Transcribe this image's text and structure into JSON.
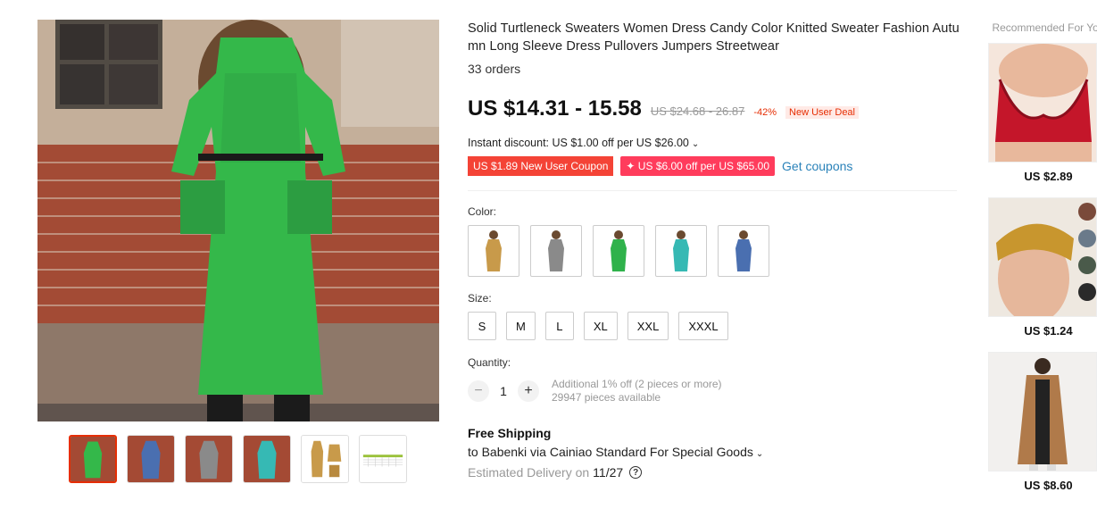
{
  "product": {
    "title": "Solid Turtleneck Sweaters Women Dress Candy Color Knitted Sweater Fashion Autumn Long Sleeve Dress Pullovers Jumpers Streetwear",
    "orders": "33 orders",
    "price": "US $14.31 - 15.58",
    "old_price": "US $24.68 - 26.87",
    "discount": "-42%",
    "deal_badge": "New User Deal",
    "instant_discount": "Instant discount: US $1.00 off per US $26.00",
    "chevron": "⌄",
    "coupon_1": "US $1.89 New User Coupon",
    "coupon_2": "✦ US $6.00 off per US $65.00",
    "get_coupons": "Get coupons"
  },
  "options": {
    "color_label": "Color:",
    "colors": [
      {
        "name": "camel",
        "color": "#c89a4a"
      },
      {
        "name": "gray",
        "color": "#8a8a8a"
      },
      {
        "name": "green",
        "color": "#2fb24b"
      },
      {
        "name": "teal",
        "color": "#36b9b4"
      },
      {
        "name": "blue",
        "color": "#4a6fb0"
      }
    ],
    "size_label": "Size:",
    "sizes": [
      "S",
      "M",
      "L",
      "XL",
      "XXL",
      "XXXL"
    ],
    "quantity_label": "Quantity:",
    "quantity": "1",
    "minus": "−",
    "plus": "+",
    "qty_note_1": "Additional 1% off (2 pieces or more)",
    "qty_note_2": "29947 pieces available"
  },
  "shipping": {
    "title": "Free Shipping",
    "line": "to Babenki via Cainiao Standard For Special Goods",
    "est_label": "Estimated Delivery on",
    "est_date": "11/27",
    "help": "?"
  },
  "recommended": {
    "title": "Recommended For You",
    "items": [
      {
        "price": "US $2.89"
      },
      {
        "price": "US $1.24"
      },
      {
        "price": "US $8.60"
      }
    ]
  },
  "colors": {
    "accent_red": "#e62e04",
    "coupon_red": "#f44336",
    "coupon_pink": "#ff3c5c",
    "link_blue": "#2a82b9"
  }
}
